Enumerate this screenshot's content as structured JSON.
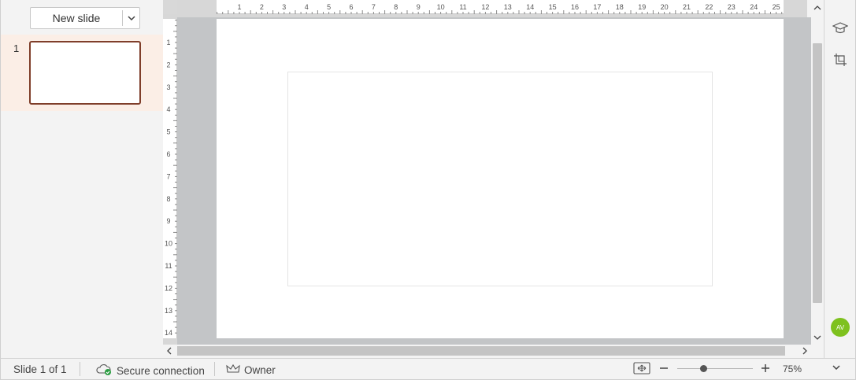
{
  "sidebar": {
    "new_slide_label": "New slide",
    "thumbnails": [
      {
        "number": "1"
      }
    ]
  },
  "ruler": {
    "horizontal_labels": [
      "1",
      "2",
      "3",
      "4",
      "5",
      "6",
      "7",
      "8",
      "9",
      "10",
      "11",
      "12",
      "13",
      "14",
      "15",
      "16",
      "17",
      "18",
      "19",
      "20",
      "21",
      "22",
      "23",
      "24",
      "25"
    ],
    "vertical_labels": [
      "1",
      "2",
      "3",
      "4",
      "5",
      "6",
      "7",
      "8",
      "9",
      "10",
      "11",
      "12",
      "13",
      "14"
    ]
  },
  "status": {
    "slide_counter": "Slide 1 of 1",
    "connection": "Secure connection",
    "role": "Owner",
    "zoom": "75%"
  },
  "user": {
    "initials": "AV",
    "avatar_color": "#7ec11e"
  },
  "colors": {
    "thumb_selected_border": "#7f3e2a",
    "thumb_selected_bg": "#fbeee6",
    "connection_ok": "#2e9e44"
  }
}
